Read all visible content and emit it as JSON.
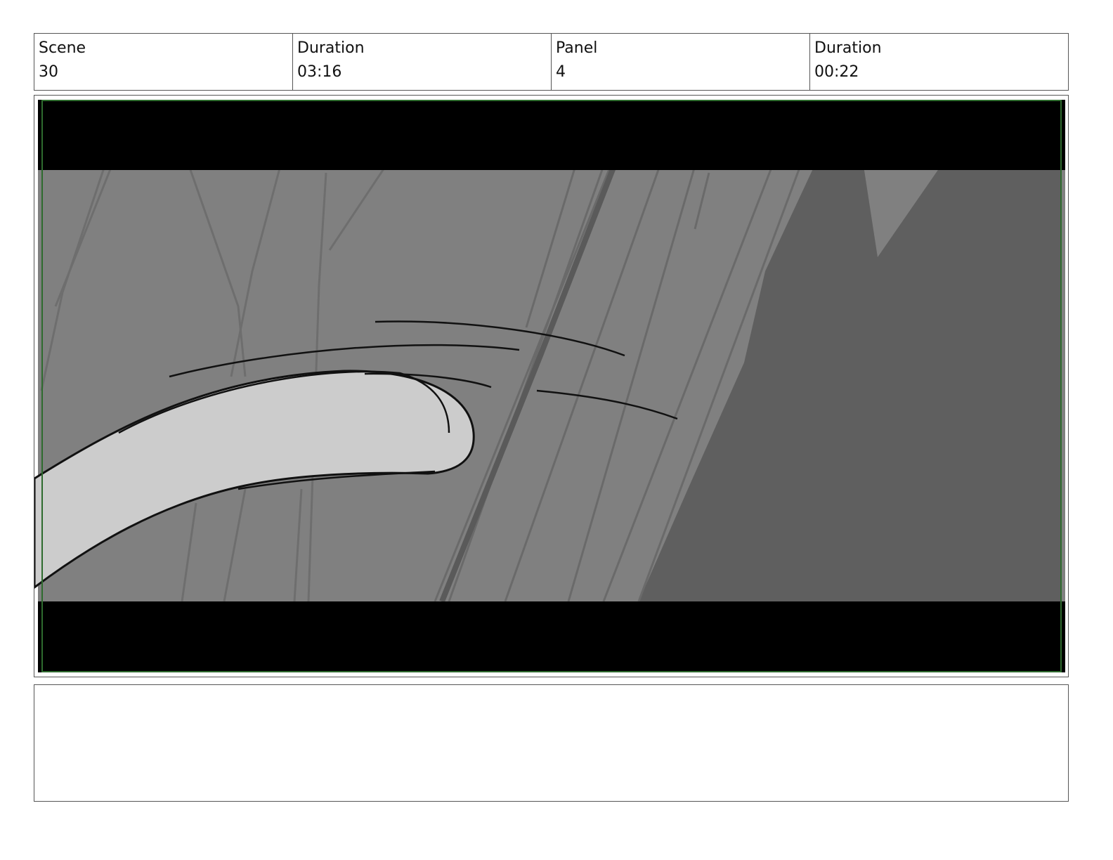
{
  "header": {
    "scene_label": "Scene",
    "scene_value": "30",
    "scene_duration_label": "Duration",
    "scene_duration_value": "03:16",
    "panel_label": "Panel",
    "panel_value": "4",
    "panel_duration_label": "Duration",
    "panel_duration_value": "00:22"
  },
  "notes": {
    "text": ""
  },
  "colors": {
    "letterbox": "#000000",
    "background_gray": "#808080",
    "shadow_dark": "#5f5f5f",
    "highlight_light": "#cccccc",
    "safe_frame_green": "#2e6b2e"
  }
}
